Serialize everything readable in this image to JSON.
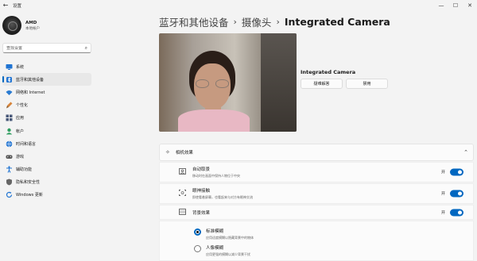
{
  "window": {
    "back_glyph": "←",
    "title": "设置",
    "controls": [
      "—",
      "☐",
      "✕"
    ]
  },
  "profile": {
    "name": "AMD",
    "account_type": "本地帐户"
  },
  "search": {
    "placeholder": "查找设置"
  },
  "sidebar": {
    "items": [
      {
        "label": "系统",
        "icon": "monitor-icon",
        "color": "#1f73d2"
      },
      {
        "label": "蓝牙和其他设备",
        "icon": "bluetooth-icon",
        "color": "#1f73d2",
        "active": true
      },
      {
        "label": "网络和 Internet",
        "icon": "network-icon",
        "color": "#2a7bd1"
      },
      {
        "label": "个性化",
        "icon": "brush-icon",
        "color": "#d6843a"
      },
      {
        "label": "应用",
        "icon": "apps-icon",
        "color": "#4a5a7a"
      },
      {
        "label": "帐户",
        "icon": "account-icon",
        "color": "#2e9d5f"
      },
      {
        "label": "时间和语言",
        "icon": "globe-icon",
        "color": "#1f73d2"
      },
      {
        "label": "游戏",
        "icon": "gamepad-icon",
        "color": "#555555"
      },
      {
        "label": "辅助功能",
        "icon": "accessibility-icon",
        "color": "#1f73d2"
      },
      {
        "label": "隐私和安全性",
        "icon": "shield-icon",
        "color": "#666666"
      },
      {
        "label": "Windows 更新",
        "icon": "update-icon",
        "color": "#1f73d2"
      }
    ]
  },
  "breadcrumb": {
    "items": [
      "蓝牙和其他设备",
      "摄像头"
    ],
    "separator": "›",
    "current": "Integrated Camera"
  },
  "camera": {
    "name": "Integrated Camera",
    "troubleshoot_label": "疑难解答",
    "disable_label": "禁用"
  },
  "effects": {
    "title": "相机效果",
    "icon": "sparkle-icon",
    "expanded": true,
    "rows": [
      {
        "title": "自动取景",
        "description": "移动时在画面中保持人物位于中央",
        "toggle_label": "开",
        "on": true,
        "icon": "frame-icon"
      },
      {
        "title": "眼神接触",
        "description": "即使看着屏幕，也看起来与对方有眼神交流",
        "toggle_label": "开",
        "on": true,
        "icon": "eye-contact-icon"
      },
      {
        "title": "背景效果",
        "description": "",
        "toggle_label": "开",
        "on": true,
        "icon": "background-icon"
      }
    ],
    "background_options": [
      {
        "title": "标准模糊",
        "description": "应用适度模糊以隐藏背景中的物体",
        "checked": true
      },
      {
        "title": "人像模糊",
        "description": "应用更强的模糊以减少背景干扰",
        "checked": false
      }
    ]
  },
  "colors": {
    "accent": "#0067c0",
    "background": "#f3f3f3",
    "card": "#fbfbfb"
  }
}
